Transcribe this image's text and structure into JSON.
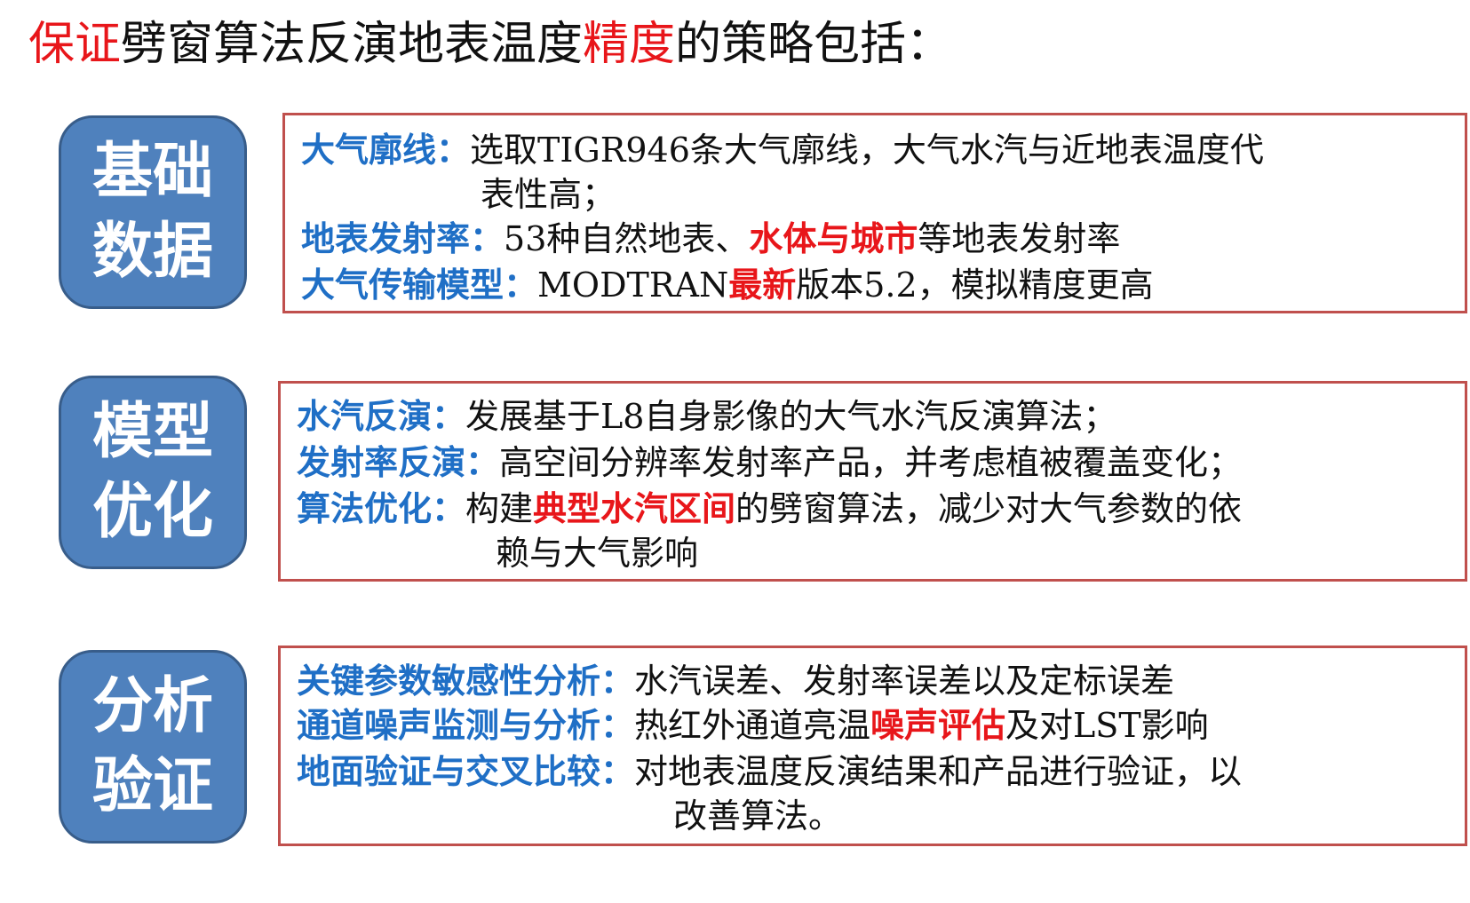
{
  "title": {
    "part1": "保证",
    "part2": "劈窗算法反演地表温度",
    "part3": "精度",
    "part4": "的策略包括："
  },
  "sections": [
    {
      "badge_line1": "基础",
      "badge_line2": "数据",
      "items": [
        {
          "label": "大气廓线：",
          "text": "选取TIGR946条大气廓线，大气水汽与近地表温度代",
          "cont": "表性高；"
        },
        {
          "label": "地表发射率：",
          "pre": "53种自然地表、",
          "hl": "水体与城市",
          "post": "等地表发射率"
        },
        {
          "label": "大气传输模型：",
          "pre": "MODTRAN",
          "hl": "最新",
          "post": "版本5.2，模拟精度更高"
        }
      ]
    },
    {
      "badge_line1": "模型",
      "badge_line2": "优化",
      "items": [
        {
          "label": "水汽反演：",
          "text": "发展基于L8自身影像的大气水汽反演算法；"
        },
        {
          "label": "发射率反演：",
          "text": "高空间分辨率发射率产品，并考虑植被覆盖变化；"
        },
        {
          "label": "算法优化：",
          "pre": "构建",
          "hl": "典型水汽区间",
          "post": "的劈窗算法，减少对大气参数的依",
          "cont": "赖与大气影响"
        }
      ]
    },
    {
      "badge_line1": "分析",
      "badge_line2": "验证",
      "items": [
        {
          "label": "关键参数敏感性分析：",
          "text": "水汽误差、发射率误差以及定标误差"
        },
        {
          "label": "通道噪声监测与分析：",
          "pre": "热红外通道亮温",
          "hl": "噪声评估",
          "post": "及对LST影响"
        },
        {
          "label": "地面验证与交叉比较：",
          "text": "对地表温度反演结果和产品进行验证，以",
          "cont": "改善算法。"
        }
      ]
    }
  ]
}
